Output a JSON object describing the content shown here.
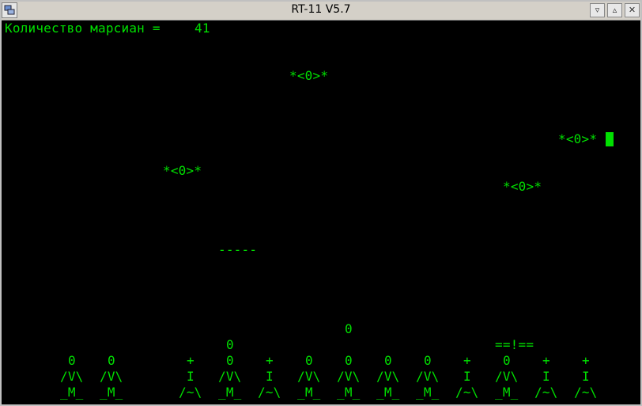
{
  "window": {
    "title": "RT-11 V5.7",
    "minimize_glyph": "▿",
    "restore_glyph": "▵",
    "close_glyph": "✕"
  },
  "hud": {
    "label": "Количество марсиан =",
    "count": "41"
  },
  "martians": [
    {
      "text": "*<0>*"
    },
    {
      "text": "*<0>*"
    },
    {
      "text": "*<0>*"
    },
    {
      "text": "*<0>*"
    }
  ],
  "bomb": "-----",
  "flying_ship": "0",
  "launch_cannon": {
    "head": "0",
    "body": "==!=="
  },
  "defenders": [
    {
      "lines": [
        "0",
        "/V\\",
        "_M_"
      ]
    },
    {
      "lines": [
        "0",
        "/V\\",
        "_M_"
      ]
    },
    {
      "lines": [
        "+",
        "I",
        "/~\\"
      ]
    },
    {
      "lines": [
        "0",
        "0",
        "/V\\",
        "_M_"
      ]
    },
    {
      "lines": [
        "+",
        "I",
        "/~\\"
      ]
    },
    {
      "lines": [
        "0",
        "/V\\",
        "_M_"
      ]
    },
    {
      "lines": [
        "0",
        "/V\\",
        "_M_"
      ]
    },
    {
      "lines": [
        "0",
        "/V\\",
        "_M_"
      ]
    },
    {
      "lines": [
        "0",
        "/V\\",
        "_M_"
      ]
    },
    {
      "lines": [
        "+",
        "I",
        "/~\\"
      ]
    },
    {
      "lines": [
        "0",
        "/V\\",
        "_M_"
      ]
    },
    {
      "lines": [
        "+",
        "I",
        "/~\\"
      ]
    },
    {
      "lines": [
        "+",
        "I",
        "/~\\"
      ]
    }
  ],
  "colors": {
    "terminal_green": "#00e000",
    "background": "#000000",
    "titlebar": "#d4d0c8"
  }
}
